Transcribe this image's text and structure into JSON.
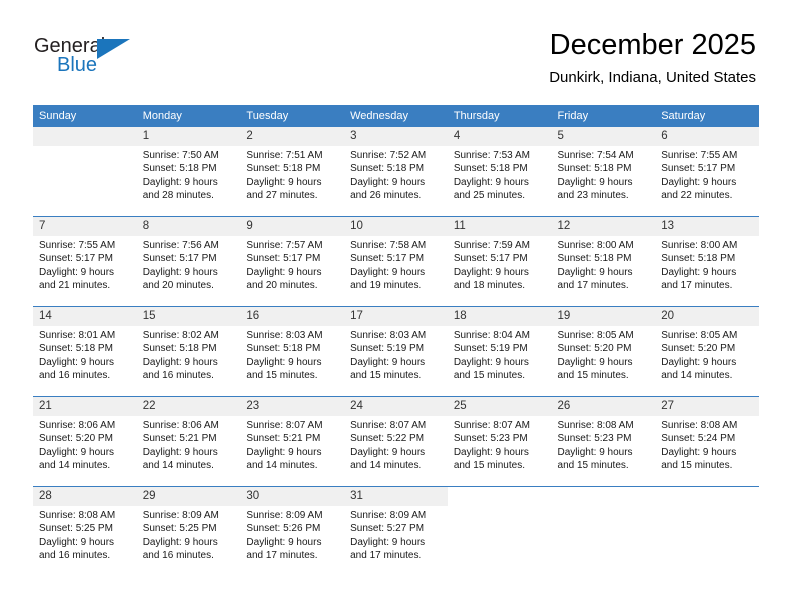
{
  "brand": {
    "name_part1": "General",
    "name_part2": "Blue",
    "accent_color": "#1b75bc"
  },
  "header": {
    "month_title": "December 2025",
    "location": "Dunkirk, Indiana, United States"
  },
  "theme": {
    "header_row_color": "#3a7ec1",
    "daynum_band_color": "#f0f0f0"
  },
  "weekday_headers": [
    "Sunday",
    "Monday",
    "Tuesday",
    "Wednesday",
    "Thursday",
    "Friday",
    "Saturday"
  ],
  "weeks": [
    [
      {
        "day": "",
        "sunrise": "",
        "sunset": "",
        "daylight_line1": "",
        "daylight_line2": "",
        "blank": true
      },
      {
        "day": "1",
        "sunrise": "Sunrise: 7:50 AM",
        "sunset": "Sunset: 5:18 PM",
        "daylight_line1": "Daylight: 9 hours",
        "daylight_line2": "and 28 minutes."
      },
      {
        "day": "2",
        "sunrise": "Sunrise: 7:51 AM",
        "sunset": "Sunset: 5:18 PM",
        "daylight_line1": "Daylight: 9 hours",
        "daylight_line2": "and 27 minutes."
      },
      {
        "day": "3",
        "sunrise": "Sunrise: 7:52 AM",
        "sunset": "Sunset: 5:18 PM",
        "daylight_line1": "Daylight: 9 hours",
        "daylight_line2": "and 26 minutes."
      },
      {
        "day": "4",
        "sunrise": "Sunrise: 7:53 AM",
        "sunset": "Sunset: 5:18 PM",
        "daylight_line1": "Daylight: 9 hours",
        "daylight_line2": "and 25 minutes."
      },
      {
        "day": "5",
        "sunrise": "Sunrise: 7:54 AM",
        "sunset": "Sunset: 5:18 PM",
        "daylight_line1": "Daylight: 9 hours",
        "daylight_line2": "and 23 minutes."
      },
      {
        "day": "6",
        "sunrise": "Sunrise: 7:55 AM",
        "sunset": "Sunset: 5:17 PM",
        "daylight_line1": "Daylight: 9 hours",
        "daylight_line2": "and 22 minutes."
      }
    ],
    [
      {
        "day": "7",
        "sunrise": "Sunrise: 7:55 AM",
        "sunset": "Sunset: 5:17 PM",
        "daylight_line1": "Daylight: 9 hours",
        "daylight_line2": "and 21 minutes."
      },
      {
        "day": "8",
        "sunrise": "Sunrise: 7:56 AM",
        "sunset": "Sunset: 5:17 PM",
        "daylight_line1": "Daylight: 9 hours",
        "daylight_line2": "and 20 minutes."
      },
      {
        "day": "9",
        "sunrise": "Sunrise: 7:57 AM",
        "sunset": "Sunset: 5:17 PM",
        "daylight_line1": "Daylight: 9 hours",
        "daylight_line2": "and 20 minutes."
      },
      {
        "day": "10",
        "sunrise": "Sunrise: 7:58 AM",
        "sunset": "Sunset: 5:17 PM",
        "daylight_line1": "Daylight: 9 hours",
        "daylight_line2": "and 19 minutes."
      },
      {
        "day": "11",
        "sunrise": "Sunrise: 7:59 AM",
        "sunset": "Sunset: 5:17 PM",
        "daylight_line1": "Daylight: 9 hours",
        "daylight_line2": "and 18 minutes."
      },
      {
        "day": "12",
        "sunrise": "Sunrise: 8:00 AM",
        "sunset": "Sunset: 5:18 PM",
        "daylight_line1": "Daylight: 9 hours",
        "daylight_line2": "and 17 minutes."
      },
      {
        "day": "13",
        "sunrise": "Sunrise: 8:00 AM",
        "sunset": "Sunset: 5:18 PM",
        "daylight_line1": "Daylight: 9 hours",
        "daylight_line2": "and 17 minutes."
      }
    ],
    [
      {
        "day": "14",
        "sunrise": "Sunrise: 8:01 AM",
        "sunset": "Sunset: 5:18 PM",
        "daylight_line1": "Daylight: 9 hours",
        "daylight_line2": "and 16 minutes."
      },
      {
        "day": "15",
        "sunrise": "Sunrise: 8:02 AM",
        "sunset": "Sunset: 5:18 PM",
        "daylight_line1": "Daylight: 9 hours",
        "daylight_line2": "and 16 minutes."
      },
      {
        "day": "16",
        "sunrise": "Sunrise: 8:03 AM",
        "sunset": "Sunset: 5:18 PM",
        "daylight_line1": "Daylight: 9 hours",
        "daylight_line2": "and 15 minutes."
      },
      {
        "day": "17",
        "sunrise": "Sunrise: 8:03 AM",
        "sunset": "Sunset: 5:19 PM",
        "daylight_line1": "Daylight: 9 hours",
        "daylight_line2": "and 15 minutes."
      },
      {
        "day": "18",
        "sunrise": "Sunrise: 8:04 AM",
        "sunset": "Sunset: 5:19 PM",
        "daylight_line1": "Daylight: 9 hours",
        "daylight_line2": "and 15 minutes."
      },
      {
        "day": "19",
        "sunrise": "Sunrise: 8:05 AM",
        "sunset": "Sunset: 5:20 PM",
        "daylight_line1": "Daylight: 9 hours",
        "daylight_line2": "and 15 minutes."
      },
      {
        "day": "20",
        "sunrise": "Sunrise: 8:05 AM",
        "sunset": "Sunset: 5:20 PM",
        "daylight_line1": "Daylight: 9 hours",
        "daylight_line2": "and 14 minutes."
      }
    ],
    [
      {
        "day": "21",
        "sunrise": "Sunrise: 8:06 AM",
        "sunset": "Sunset: 5:20 PM",
        "daylight_line1": "Daylight: 9 hours",
        "daylight_line2": "and 14 minutes."
      },
      {
        "day": "22",
        "sunrise": "Sunrise: 8:06 AM",
        "sunset": "Sunset: 5:21 PM",
        "daylight_line1": "Daylight: 9 hours",
        "daylight_line2": "and 14 minutes."
      },
      {
        "day": "23",
        "sunrise": "Sunrise: 8:07 AM",
        "sunset": "Sunset: 5:21 PM",
        "daylight_line1": "Daylight: 9 hours",
        "daylight_line2": "and 14 minutes."
      },
      {
        "day": "24",
        "sunrise": "Sunrise: 8:07 AM",
        "sunset": "Sunset: 5:22 PM",
        "daylight_line1": "Daylight: 9 hours",
        "daylight_line2": "and 14 minutes."
      },
      {
        "day": "25",
        "sunrise": "Sunrise: 8:07 AM",
        "sunset": "Sunset: 5:23 PM",
        "daylight_line1": "Daylight: 9 hours",
        "daylight_line2": "and 15 minutes."
      },
      {
        "day": "26",
        "sunrise": "Sunrise: 8:08 AM",
        "sunset": "Sunset: 5:23 PM",
        "daylight_line1": "Daylight: 9 hours",
        "daylight_line2": "and 15 minutes."
      },
      {
        "day": "27",
        "sunrise": "Sunrise: 8:08 AM",
        "sunset": "Sunset: 5:24 PM",
        "daylight_line1": "Daylight: 9 hours",
        "daylight_line2": "and 15 minutes."
      }
    ],
    [
      {
        "day": "28",
        "sunrise": "Sunrise: 8:08 AM",
        "sunset": "Sunset: 5:25 PM",
        "daylight_line1": "Daylight: 9 hours",
        "daylight_line2": "and 16 minutes."
      },
      {
        "day": "29",
        "sunrise": "Sunrise: 8:09 AM",
        "sunset": "Sunset: 5:25 PM",
        "daylight_line1": "Daylight: 9 hours",
        "daylight_line2": "and 16 minutes."
      },
      {
        "day": "30",
        "sunrise": "Sunrise: 8:09 AM",
        "sunset": "Sunset: 5:26 PM",
        "daylight_line1": "Daylight: 9 hours",
        "daylight_line2": "and 17 minutes."
      },
      {
        "day": "31",
        "sunrise": "Sunrise: 8:09 AM",
        "sunset": "Sunset: 5:27 PM",
        "daylight_line1": "Daylight: 9 hours",
        "daylight_line2": "and 17 minutes."
      },
      {
        "day": "",
        "sunrise": "",
        "sunset": "",
        "daylight_line1": "",
        "daylight_line2": "",
        "blank": true
      },
      {
        "day": "",
        "sunrise": "",
        "sunset": "",
        "daylight_line1": "",
        "daylight_line2": "",
        "blank": true
      },
      {
        "day": "",
        "sunrise": "",
        "sunset": "",
        "daylight_line1": "",
        "daylight_line2": "",
        "blank": true
      }
    ]
  ]
}
